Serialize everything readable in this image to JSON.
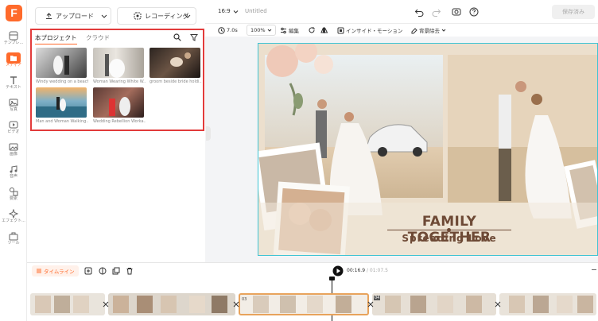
{
  "app": {
    "logo_letter": "F",
    "project_name": "Untitled",
    "export_label": "保存済み"
  },
  "rail": {
    "items": [
      {
        "id": "template",
        "label": "テンプレ..."
      },
      {
        "id": "media",
        "label": "メディア"
      },
      {
        "id": "text",
        "label": "テキスト"
      },
      {
        "id": "photo",
        "label": "写真"
      },
      {
        "id": "video",
        "label": "ビデオ"
      },
      {
        "id": "image",
        "label": "画像"
      },
      {
        "id": "audio",
        "label": "音声"
      },
      {
        "id": "element",
        "label": "要素"
      },
      {
        "id": "effect",
        "label": "エフェクト..."
      },
      {
        "id": "tools",
        "label": "ツール"
      }
    ]
  },
  "panel": {
    "upload_label": "アップロード",
    "record_label": "レコーディング",
    "tabs": [
      "本プロジェクト",
      "クラウド"
    ],
    "media": [
      {
        "caption": "Windy wedding on a beach"
      },
      {
        "caption": "Woman Wearing White W..."
      },
      {
        "caption": "groom beside bride holdi..."
      },
      {
        "caption": "Man and Woman Walking..."
      },
      {
        "caption": "Wedding Rebellion Worka..."
      }
    ]
  },
  "topbar": {
    "ratio": "16:9"
  },
  "toolbar": {
    "duration": "7.0s",
    "zoom": "100%",
    "edit": "編集",
    "inside_motion": "インサイド・モーション",
    "bg_removal": "背景除去"
  },
  "video": {
    "title": "FAMILY TOGETHER",
    "subtitle": "Spreading Love"
  },
  "timeline": {
    "label": "タイムライン",
    "time_current": "00:16.9",
    "time_total": "01:07.5",
    "seg_num_a": "03",
    "seg_num_b": "04"
  },
  "colors": {
    "accent": "#ff6a2b",
    "highlight_border": "#e23b3b",
    "canvas_border": "#3fc4d4",
    "title_brown": "#6e4a36"
  }
}
